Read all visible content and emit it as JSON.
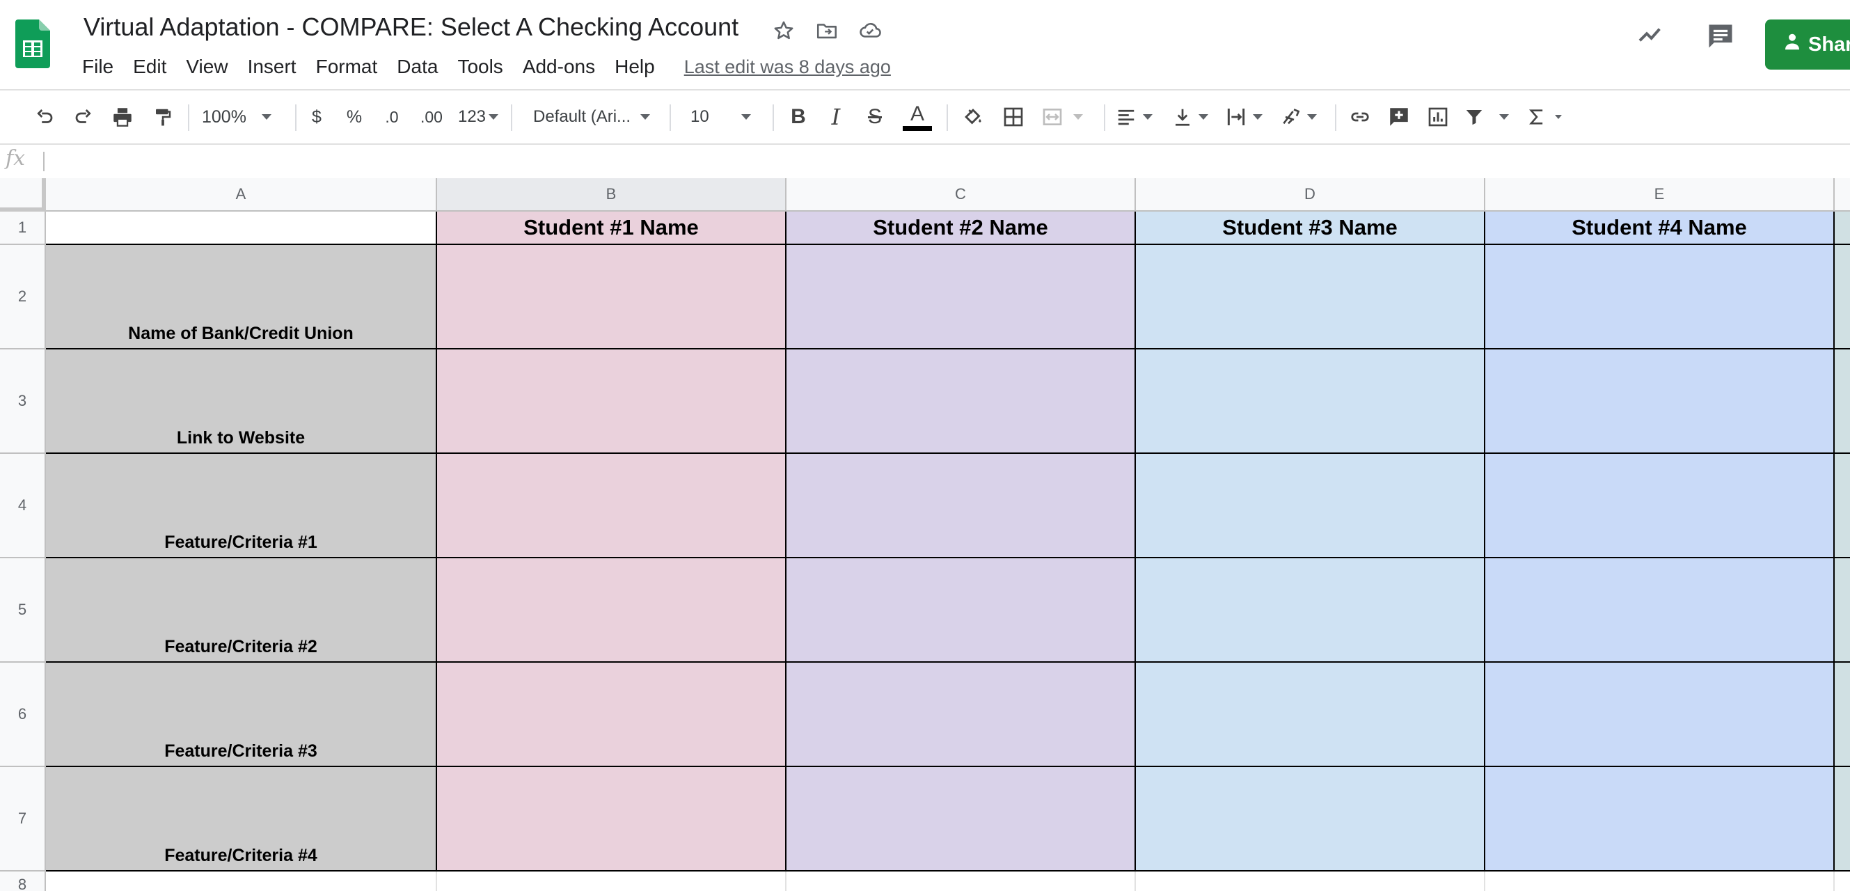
{
  "app": {
    "title": "Virtual Adaptation - COMPARE: Select A Checking Account",
    "menu": [
      "File",
      "Edit",
      "View",
      "Insert",
      "Format",
      "Data",
      "Tools",
      "Add-ons",
      "Help"
    ],
    "last_edit": "Last edit was 8 days ago",
    "share_label": "Shar"
  },
  "toolbar": {
    "zoom": "100%",
    "currency": "$",
    "percent": "%",
    "decimal_decrease": ".0",
    "decimal_increase": ".00",
    "more_formats": "123",
    "font": "Default (Ari...",
    "font_size": "10",
    "bold": "B",
    "italic": "I",
    "strikethrough": "S",
    "text_color_label": "A"
  },
  "formula_bar": {
    "fx": "fx",
    "value": ""
  },
  "sheet": {
    "columns": [
      "A",
      "B",
      "C",
      "D",
      "E"
    ],
    "rows": [
      "1",
      "2",
      "3",
      "4",
      "5",
      "6",
      "7",
      "8"
    ],
    "headers": [
      "",
      "Student #1 Name",
      "Student #2 Name",
      "Student #3 Name",
      "Student #4 Name"
    ],
    "row_labels": [
      "Name of Bank/Credit Union",
      "Link to Website",
      "Feature/Criteria #1",
      "Feature/Criteria #2",
      "Feature/Criteria #3",
      "Feature/Criteria #4"
    ],
    "selected_column": "B"
  },
  "colors": {
    "label_fill": "#cccccc",
    "student1_fill": "#ead1dc",
    "student2_fill": "#d9d2e9",
    "student3_fill": "#cfe2f3",
    "student4_fill": "#c9daf8",
    "share_green": "#1e8e3e",
    "sheets_logo_green": "#0f9d58"
  }
}
